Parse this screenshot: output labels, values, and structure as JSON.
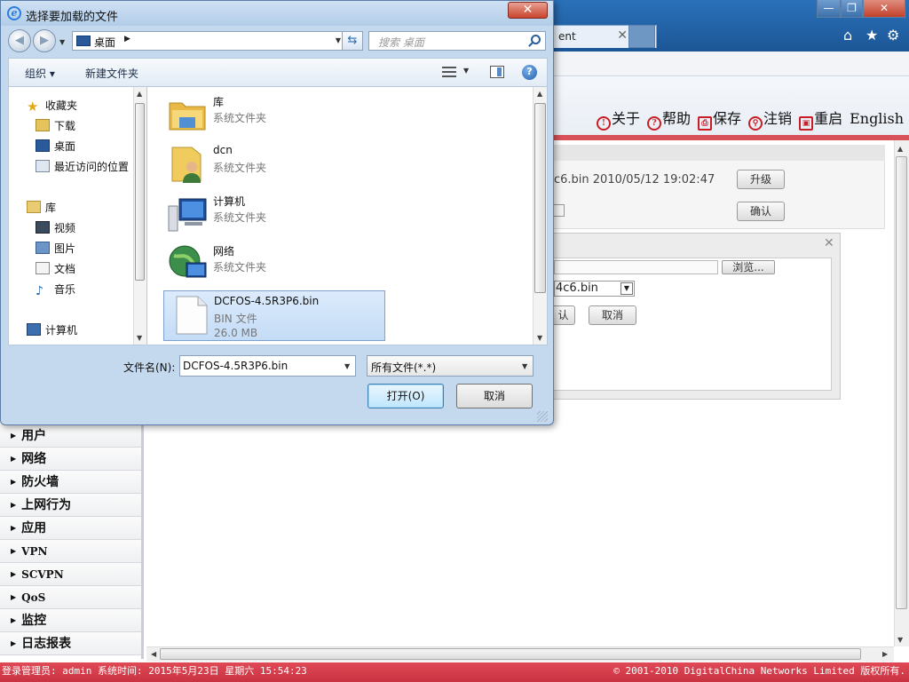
{
  "browser": {
    "tab_title": "ent",
    "tab_close": "✕",
    "win_min": "—",
    "win_max": "❐",
    "win_close": "✕",
    "header_links": [
      {
        "icon": "!",
        "label": "关于"
      },
      {
        "icon": "?",
        "label": "帮助"
      },
      {
        "icon": "⎙",
        "label": "保存"
      },
      {
        "icon": "⚲",
        "label": "注销"
      },
      {
        "icon": "▣",
        "label": "重启"
      },
      {
        "icon": "",
        "label": "English"
      }
    ]
  },
  "sidebar": {
    "items": [
      "用户",
      "网络",
      "防火墙",
      "上网行为",
      "应用",
      "VPN",
      "SCVPN",
      "QoS",
      "监控",
      "日志报表"
    ]
  },
  "firmware": {
    "info": "c6.bin 2010/05/12 19:02:47",
    "upgrade_label": "升级",
    "confirm_label": "确认",
    "browse_label": "浏览...",
    "select_value": "4c6.bin",
    "confirm2_label": "认",
    "cancel2_label": "取消"
  },
  "status": {
    "left": "登录管理员: admin 系统时间: 2015年5月23日 星期六 15:54:23",
    "right": "© 2001-2010 DigitalChina Networks Limited 版权所有."
  },
  "dialog": {
    "title": "选择要加载的文件",
    "close": "✕",
    "address": "桌面",
    "search_placeholder": "搜索 桌面",
    "organize": "组织 ▾",
    "new_folder": "新建文件夹",
    "help": "?",
    "tree": [
      {
        "icon": "star-icon",
        "label": "收藏夹"
      },
      {
        "icon": "downloads-icon",
        "label": "下载"
      },
      {
        "icon": "desktop-icon",
        "label": "桌面"
      },
      {
        "icon": "recent-icon",
        "label": "最近访问的位置"
      },
      {
        "icon": "library-icon",
        "label": "库"
      },
      {
        "icon": "video-icon",
        "label": "视频"
      },
      {
        "icon": "picture-icon",
        "label": "图片"
      },
      {
        "icon": "document-icon",
        "label": "文档"
      },
      {
        "icon": "music-icon",
        "label": "音乐"
      },
      {
        "icon": "computer-icon",
        "label": "计算机"
      }
    ],
    "files": [
      {
        "name": "库",
        "type": "系统文件夹",
        "icon": "library-folder-icon"
      },
      {
        "name": "dcn",
        "type": "系统文件夹",
        "icon": "user-folder-icon"
      },
      {
        "name": "计算机",
        "type": "系统文件夹",
        "icon": "computer-icon"
      },
      {
        "name": "网络",
        "type": "系统文件夹",
        "icon": "network-icon"
      },
      {
        "name": "DCFOS-4.5R3P6.bin",
        "type": "BIN 文件",
        "size": "26.0 MB",
        "icon": "file-icon"
      }
    ],
    "filename_label": "文件名(N):",
    "filename_value": "DCFOS-4.5R3P6.bin",
    "filetype_value": "所有文件(*.*)",
    "open_label": "打开(O)",
    "cancel_label": "取消"
  }
}
